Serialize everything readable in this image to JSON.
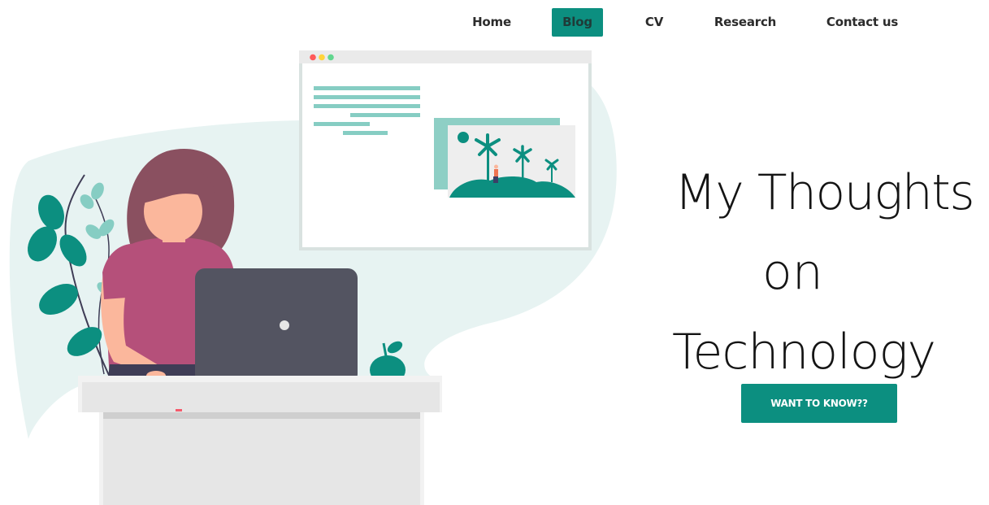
{
  "nav": {
    "items": [
      {
        "label": "Home"
      },
      {
        "label": "Blog"
      },
      {
        "label": "CV"
      },
      {
        "label": "Research"
      },
      {
        "label": "Contact us"
      }
    ],
    "active_index": 1
  },
  "hero": {
    "title_lines": [
      "My Thoughts",
      "on",
      "Technology"
    ],
    "cta_label": "WANT TO KNOW??"
  },
  "colors": {
    "accent": "#0c8f80",
    "blob": "#e7f3f2",
    "shirt": "#b5507a",
    "hair": "#8a5060",
    "skin": "#fbb79c",
    "laptop": "#535461"
  }
}
